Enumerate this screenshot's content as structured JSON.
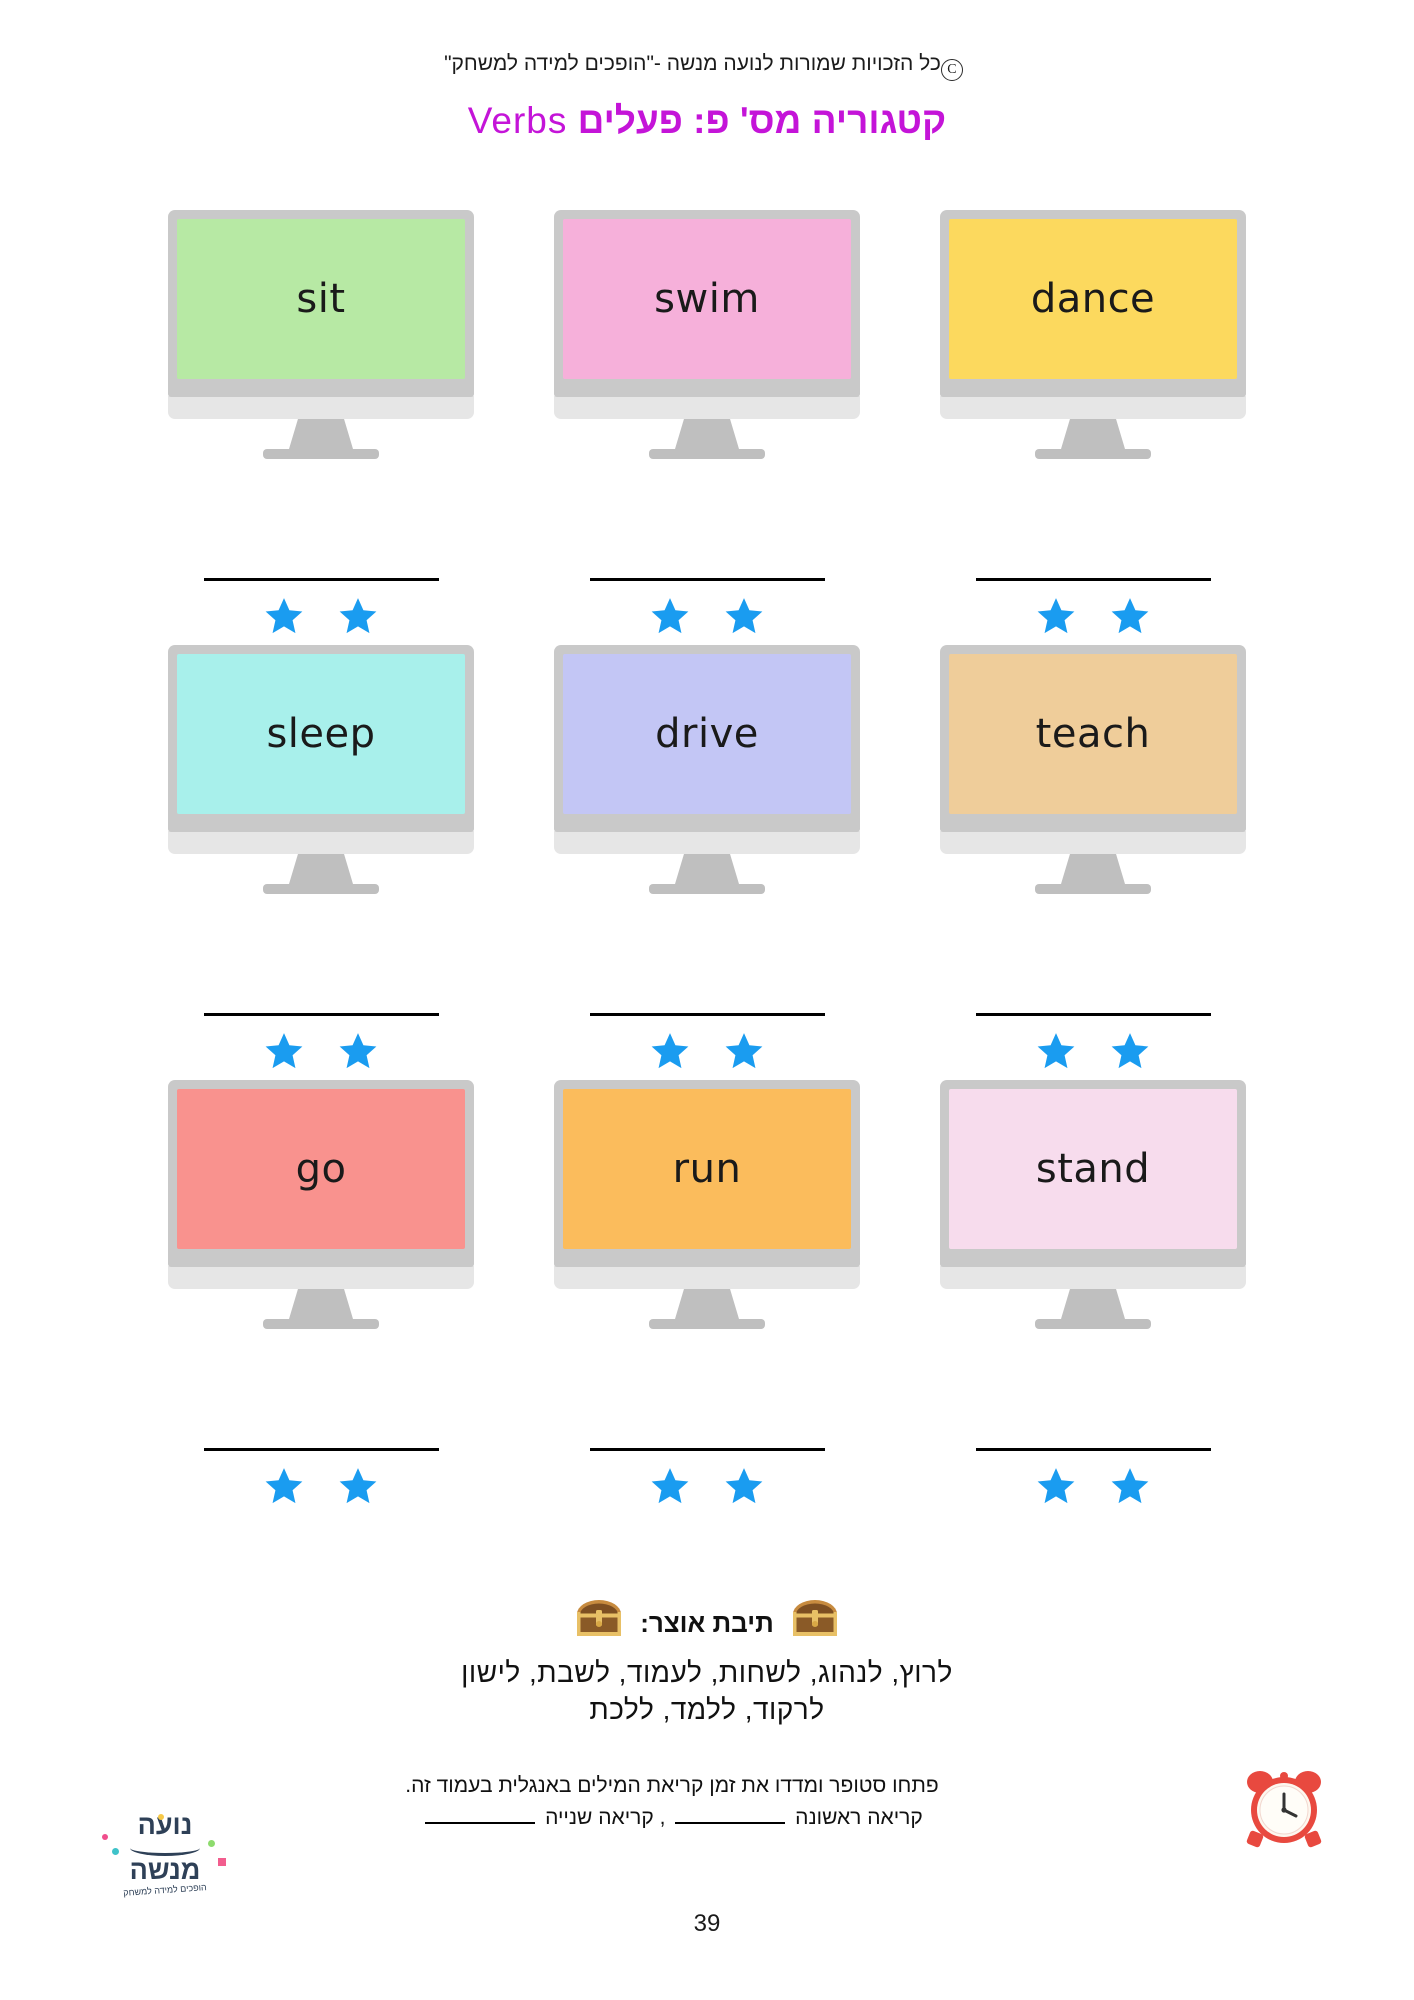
{
  "header": {
    "copyright_text": "כל הזכויות שמורות לנועה מנשה -\"הופכים למידה למשחק\"",
    "copyright_mark": "C"
  },
  "title": {
    "hebrew": "קטגוריה מס' פ: פעלים",
    "english": "Verbs",
    "color": "#c414d8"
  },
  "worksheet": {
    "cards": [
      {
        "word": "sit",
        "screen_color": "#b7e9a4",
        "frame_color": "#c9c9c9",
        "line_label": "",
        "stars": 2
      },
      {
        "word": "swim",
        "screen_color": "#f6b0da",
        "frame_color": "#c9c9c9",
        "line_label": "",
        "stars": 2
      },
      {
        "word": "dance",
        "screen_color": "#fcd95e",
        "frame_color": "#c9c9c9",
        "line_label": "",
        "stars": 2
      },
      {
        "word": "sleep",
        "screen_color": "#a8f0eb",
        "frame_color": "#c9c9c9",
        "line_label": "",
        "stars": 2
      },
      {
        "word": "drive",
        "screen_color": "#c3c6f5",
        "frame_color": "#c9c9c9",
        "line_label": "",
        "stars": 2
      },
      {
        "word": "teach",
        "screen_color": "#efcd9a",
        "frame_color": "#c9c9c9",
        "line_label": "",
        "stars": 2
      },
      {
        "word": "go",
        "screen_color": "#f9928e",
        "frame_color": "#c9c9c9",
        "line_label": "",
        "stars": 2
      },
      {
        "word": "run",
        "screen_color": "#fbbc5c",
        "frame_color": "#c9c9c9",
        "line_label": "",
        "stars": 2
      },
      {
        "word": "stand",
        "screen_color": "#f7dced",
        "frame_color": "#c9c9c9",
        "line_label": "",
        "stars": 2
      }
    ],
    "star_color": "#1a9cf0"
  },
  "treasure": {
    "label": "תיבת אוצר:",
    "chest_icon": "treasure-chest-icon",
    "word_bank_line1": "לרוץ, לנהוג, לשחות, לעמוד, לשבת, לישון",
    "word_bank_line2": "לרקוד, ללמד, ללכת"
  },
  "instructions": {
    "line1": "פתחו סטופר ומדדו את זמן קריאת המילים באנגלית בעמוד זה.",
    "reading1_label": "קריאה ראשונה",
    "separator": ",",
    "reading2_label": "קריאה שנייה",
    "clock_icon": "alarm-clock-icon"
  },
  "logo": {
    "line1": "נועה",
    "line2": "מנשה",
    "tagline": "הופכים למידה למשחק",
    "color": "#2e4057"
  },
  "footer": {
    "page_number": "39"
  }
}
